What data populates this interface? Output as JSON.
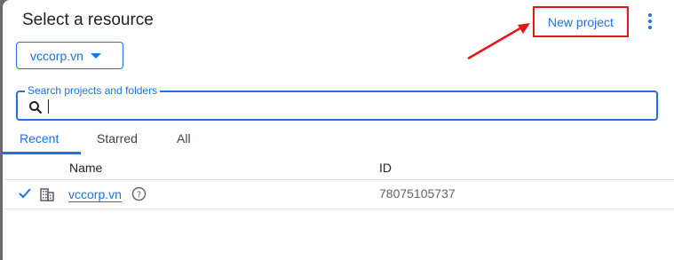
{
  "dialog": {
    "title": "Select a resource",
    "new_project_label": "New project",
    "more_icon": "more-vert-icon"
  },
  "org_selector": {
    "value": "vccorp.vn"
  },
  "search": {
    "label": "Search projects and folders",
    "value": ""
  },
  "tabs": [
    {
      "label": "Recent",
      "active": true
    },
    {
      "label": "Starred",
      "active": false
    },
    {
      "label": "All",
      "active": false
    }
  ],
  "table": {
    "columns": [
      "Name",
      "ID"
    ],
    "rows": [
      {
        "selected": true,
        "type_icon": "organization-icon",
        "name": "vccorp.vn",
        "id": "78075105737"
      }
    ]
  },
  "colors": {
    "accent": "#1a73e8",
    "highlight": "#e8141c"
  }
}
